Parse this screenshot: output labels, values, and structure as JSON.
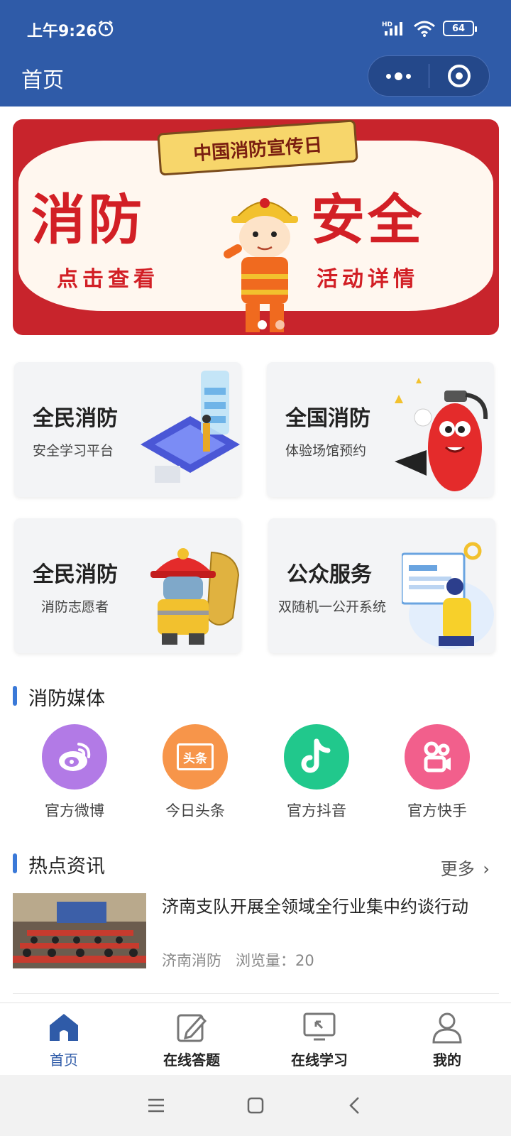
{
  "status": {
    "time": "上午9:26",
    "battery": "64",
    "network": "HD"
  },
  "nav": {
    "title": "首页"
  },
  "banner": {
    "ribbon": "中国消防宣传日",
    "left_big": "消防",
    "right_big": "安全",
    "left_small": "点击查看",
    "right_small": "活动详情",
    "slides": 2,
    "active_slide": 1
  },
  "cards": [
    {
      "title": "全民消防",
      "sub": "安全学习平台"
    },
    {
      "title": "全国消防",
      "sub": "体验场馆预约"
    },
    {
      "title": "全民消防",
      "sub": "消防志愿者"
    },
    {
      "title": "公众服务",
      "sub": "双随机一公开系统"
    }
  ],
  "media": {
    "title": "消防媒体",
    "items": [
      {
        "label": "官方微博",
        "icon": "weibo-icon",
        "color": "#b27ae6",
        "badge": ""
      },
      {
        "label": "今日头条",
        "icon": "toutiao-icon",
        "color": "#f7954a",
        "badge": "头条"
      },
      {
        "label": "官方抖音",
        "icon": "douyin-icon",
        "color": "#21c88c",
        "badge": ""
      },
      {
        "label": "官方快手",
        "icon": "kuaishou-icon",
        "color": "#f25f8c",
        "badge": ""
      }
    ]
  },
  "news": {
    "title": "热点资讯",
    "more": "更多",
    "items": [
      {
        "headline": "济南支队开展全领域全行业集中约谈行动",
        "source": "济南消防",
        "views": "浏览量：20"
      }
    ]
  },
  "tabs": [
    {
      "label": "首页",
      "icon": "home-icon",
      "active": true
    },
    {
      "label": "在线答题",
      "icon": "edit-icon",
      "active": false
    },
    {
      "label": "在线学习",
      "icon": "learning-screen-icon",
      "active": false
    },
    {
      "label": "我的",
      "icon": "user-icon",
      "active": false
    }
  ],
  "colors": {
    "brand": "#2f5ba8",
    "accent": "#3a79d8",
    "banner_red": "#c8242c"
  }
}
